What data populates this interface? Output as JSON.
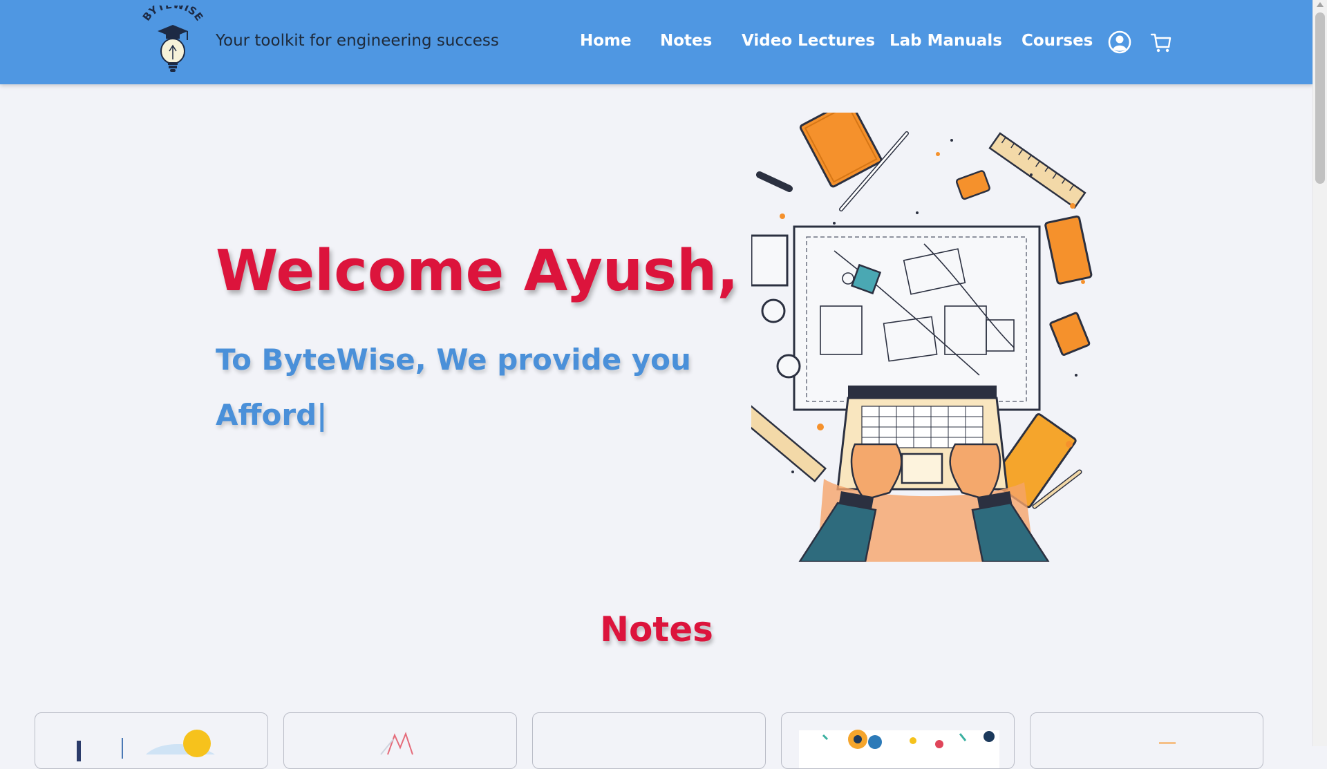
{
  "header": {
    "logo_text": "BYTEWISE",
    "tagline": "Your toolkit for engineering success",
    "nav": [
      {
        "label": "Home"
      },
      {
        "label": "Notes"
      },
      {
        "label": "Video Lectures"
      },
      {
        "label": "Lab Manuals"
      },
      {
        "label": "Courses"
      }
    ],
    "icons": [
      "user-account-icon",
      "shopping-cart-icon"
    ]
  },
  "hero": {
    "welcome": "Welcome Ayush,",
    "line1": "To ByteWise, We provide you",
    "line2_typed": "Afford",
    "cursor": "|"
  },
  "notes_section": {
    "title": "Notes"
  },
  "colors": {
    "navbar_bg": "#4f97e2",
    "welcome_red": "#dc143c",
    "subtitle_blue": "#4a90d9",
    "page_bg": "#f2f3f8",
    "illustration_orange": "#f5912c"
  }
}
